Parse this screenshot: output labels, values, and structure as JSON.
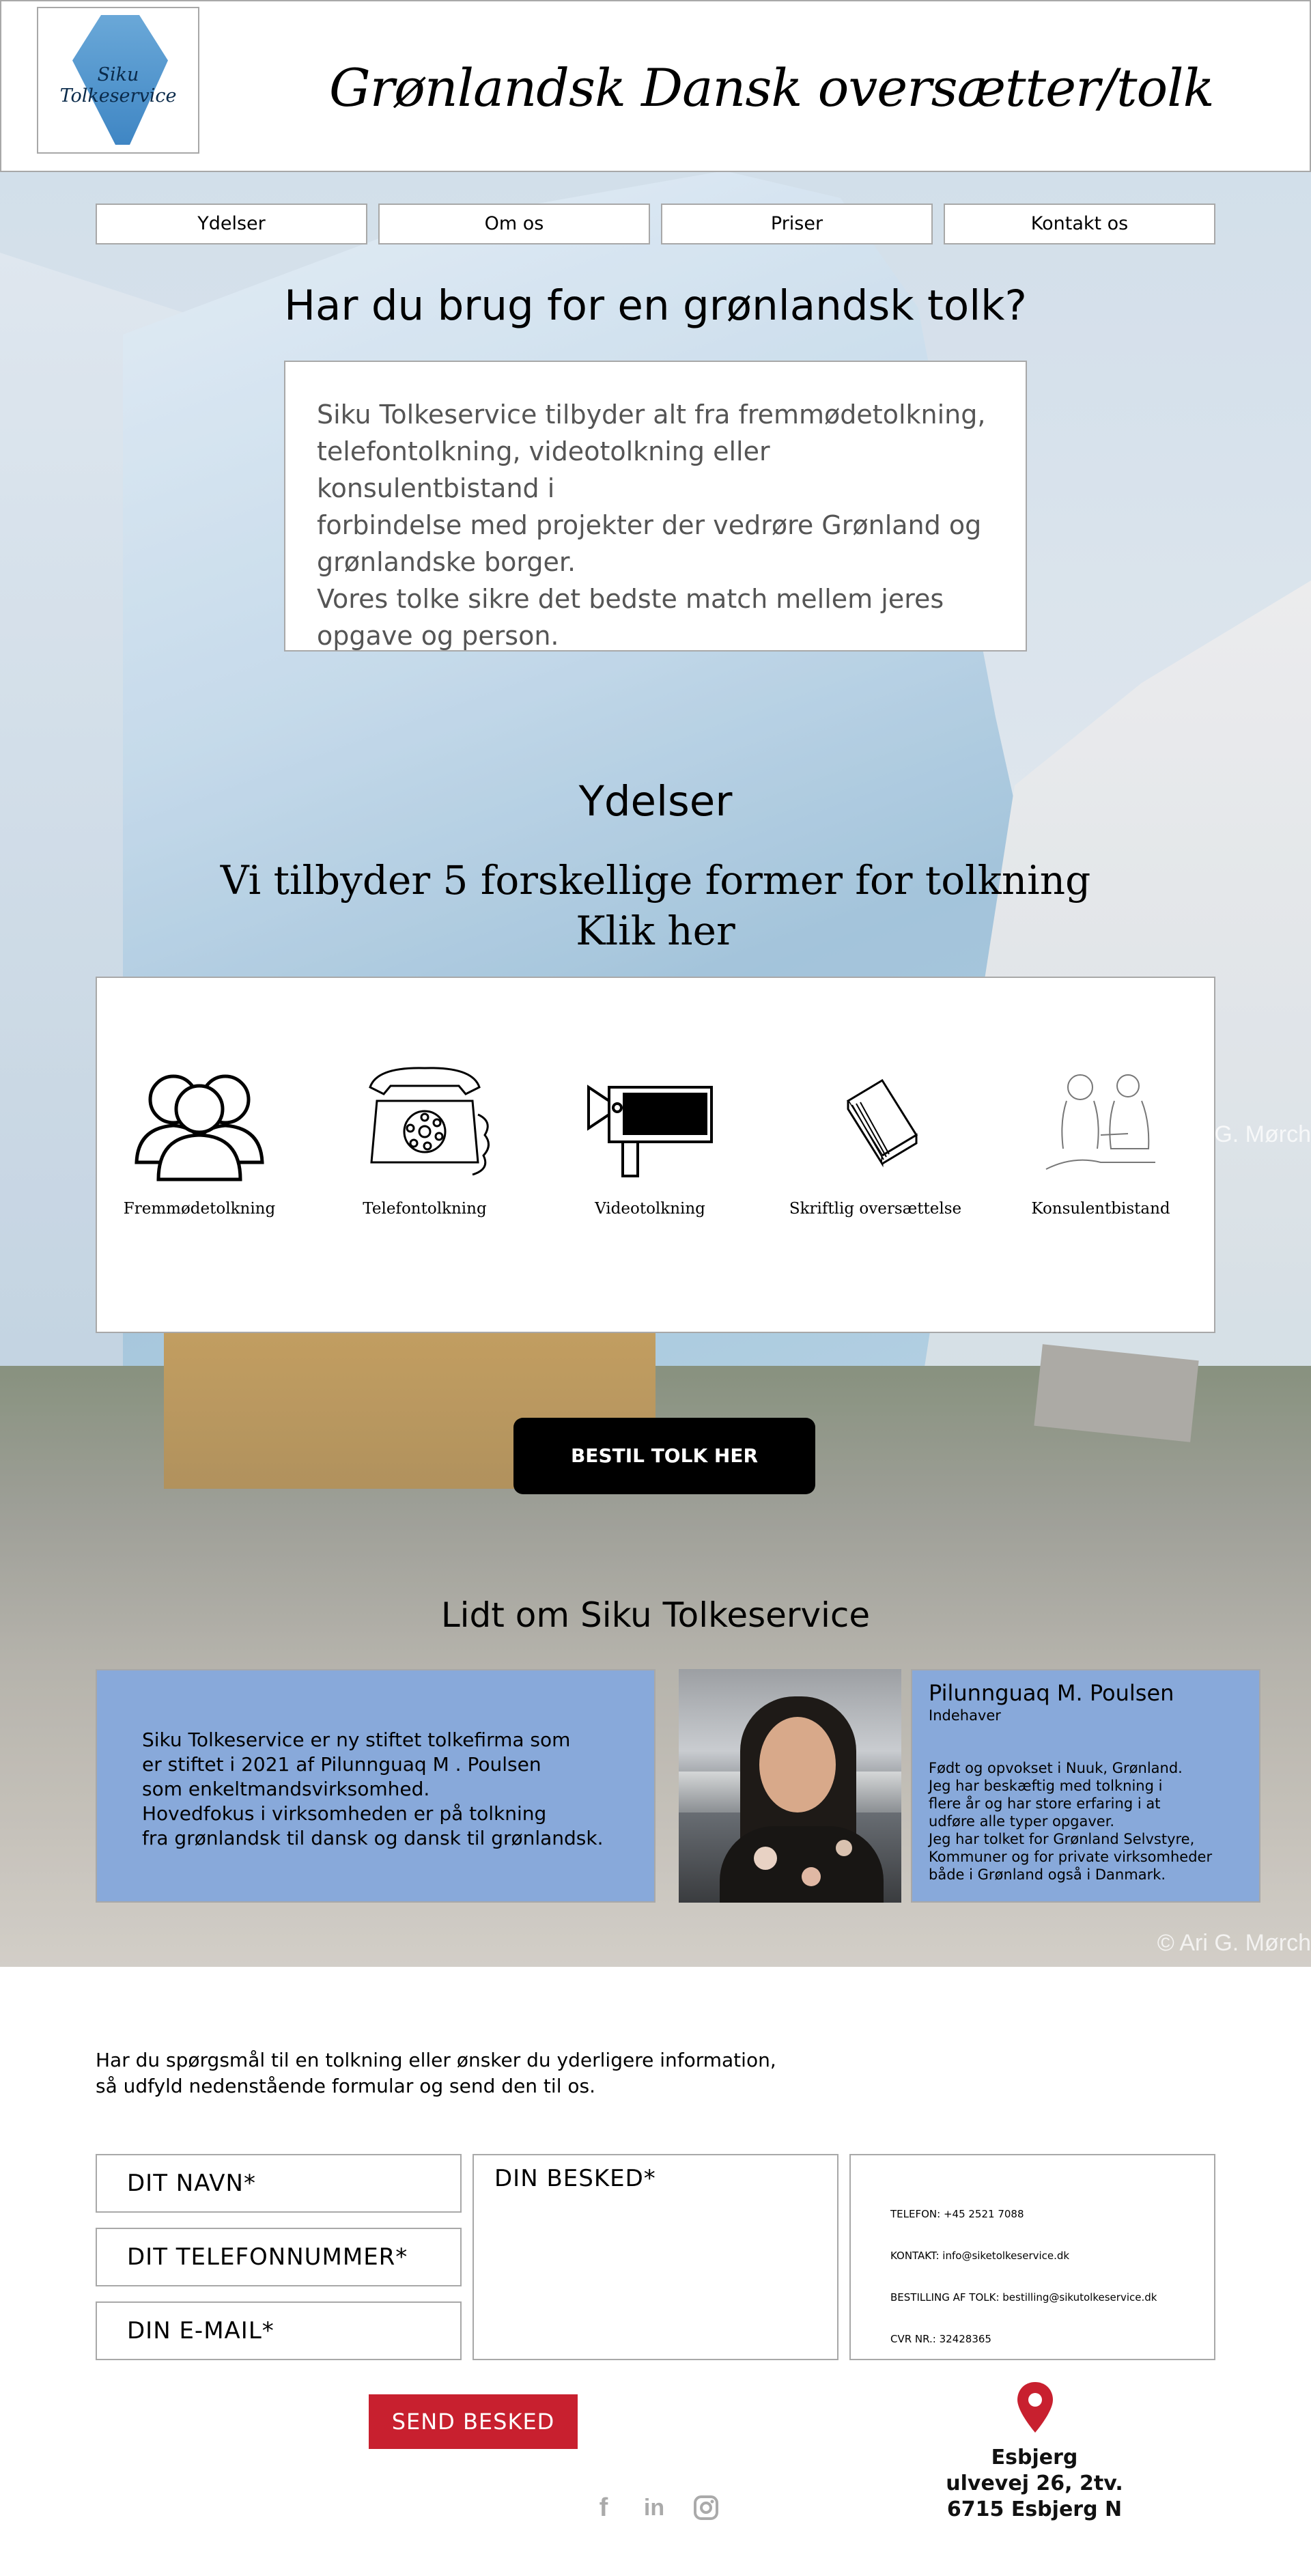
{
  "header": {
    "logo_text": "Siku Tolkeservice",
    "site_title": "Grønlandsk Dansk oversætter/tolk"
  },
  "nav": {
    "items": [
      {
        "label": "Ydelser"
      },
      {
        "label": "Om os"
      },
      {
        "label": "Priser"
      },
      {
        "label": "Kontakt os"
      }
    ]
  },
  "hero": {
    "heading": "Har du brug for en grønlandsk tolk?",
    "intro_lines": [
      "Siku Tolkeservice tilbyder alt fra fremmødetolkning,",
      "telefontolkning, videotolkning eller konsulentbistand i",
      "forbindelse med projekter der vedrøre Grønland og",
      "grønlandske borger.",
      "Vores tolke sikre det bedste match mellem jeres",
      "opgave og person."
    ]
  },
  "services": {
    "heading": "Ydelser",
    "subheading_line1": "Vi tilbyder 5 forskellige former for tolkning",
    "subheading_line2": "Klik her",
    "items": [
      {
        "label": "Fremmødetolkning",
        "icon": "people-group-icon"
      },
      {
        "label": "Telefontolkning",
        "icon": "telephone-icon"
      },
      {
        "label": "Videotolkning",
        "icon": "video-camera-icon"
      },
      {
        "label": "Skriftlig oversættelse",
        "icon": "book-icon"
      },
      {
        "label": "Konsulentbistand",
        "icon": "consultation-icon"
      }
    ],
    "order_button": "BESTIL TOLK HER"
  },
  "about": {
    "heading": "Lidt om Siku Tolkeservice",
    "text_lines": [
      "Siku Tolkeservice er ny stiftet tolkefirma som",
      "er stiftet i 2021 af Pilunnguaq M . Poulsen",
      "som enkeltmandsvirksomhed.",
      "Hovedfokus i virksomheden er på tolkning",
      "fra grønlandsk til dansk og dansk til grønlandsk."
    ],
    "person_name": "Pilunnguaq M. Poulsen",
    "person_role": "Indehaver",
    "bio_lines": [
      "Født og opvokset i Nuuk, Grønland.",
      "Jeg har beskæftig med tolkning i",
      "flere år og har store erfaring i at",
      "udføre alle typer opgaver.",
      "Jeg har tolket for Grønland Selvstyre,",
      "Kommuner og for private virksomheder",
      "både i Grønland også i Danmark."
    ]
  },
  "background": {
    "credit": "© Ari G. Mørch",
    "credit_partial": "G. Mørch"
  },
  "contact": {
    "intro_line1": "Har du spørgsmål til en tolkning eller ønsker du yderligere information,",
    "intro_line2": "så udfyld nedenstående formular og send den til os.",
    "name_placeholder": "DIT NAVN*",
    "phone_placeholder": "DIT TELEFONNUMMER*",
    "email_placeholder": "DIN E-MAIL*",
    "message_placeholder": "DIN BESKED*",
    "send_button": "SEND BESKED",
    "info": {
      "phone": "TELEFON: +45 2521 7088",
      "contact": "KONTAKT: info@siketolkeservice.dk",
      "booking": "BESTILLING AF TOLK: bestilling@sikutolkeservice.dk",
      "cvr": "CVR NR.: 32428365"
    },
    "address_line1": "Esbjerg",
    "address_line2": "ulvevej 26, 2tv.",
    "address_line3": "6715 Esbjerg N",
    "social": [
      {
        "icon": "facebook-icon",
        "glyph": "f"
      },
      {
        "icon": "linkedin-icon",
        "glyph": "in"
      },
      {
        "icon": "instagram-icon",
        "glyph": ""
      }
    ]
  },
  "colors": {
    "accent_blue": "#88a9da",
    "send_red": "#c8202f",
    "order_black": "#000000"
  }
}
